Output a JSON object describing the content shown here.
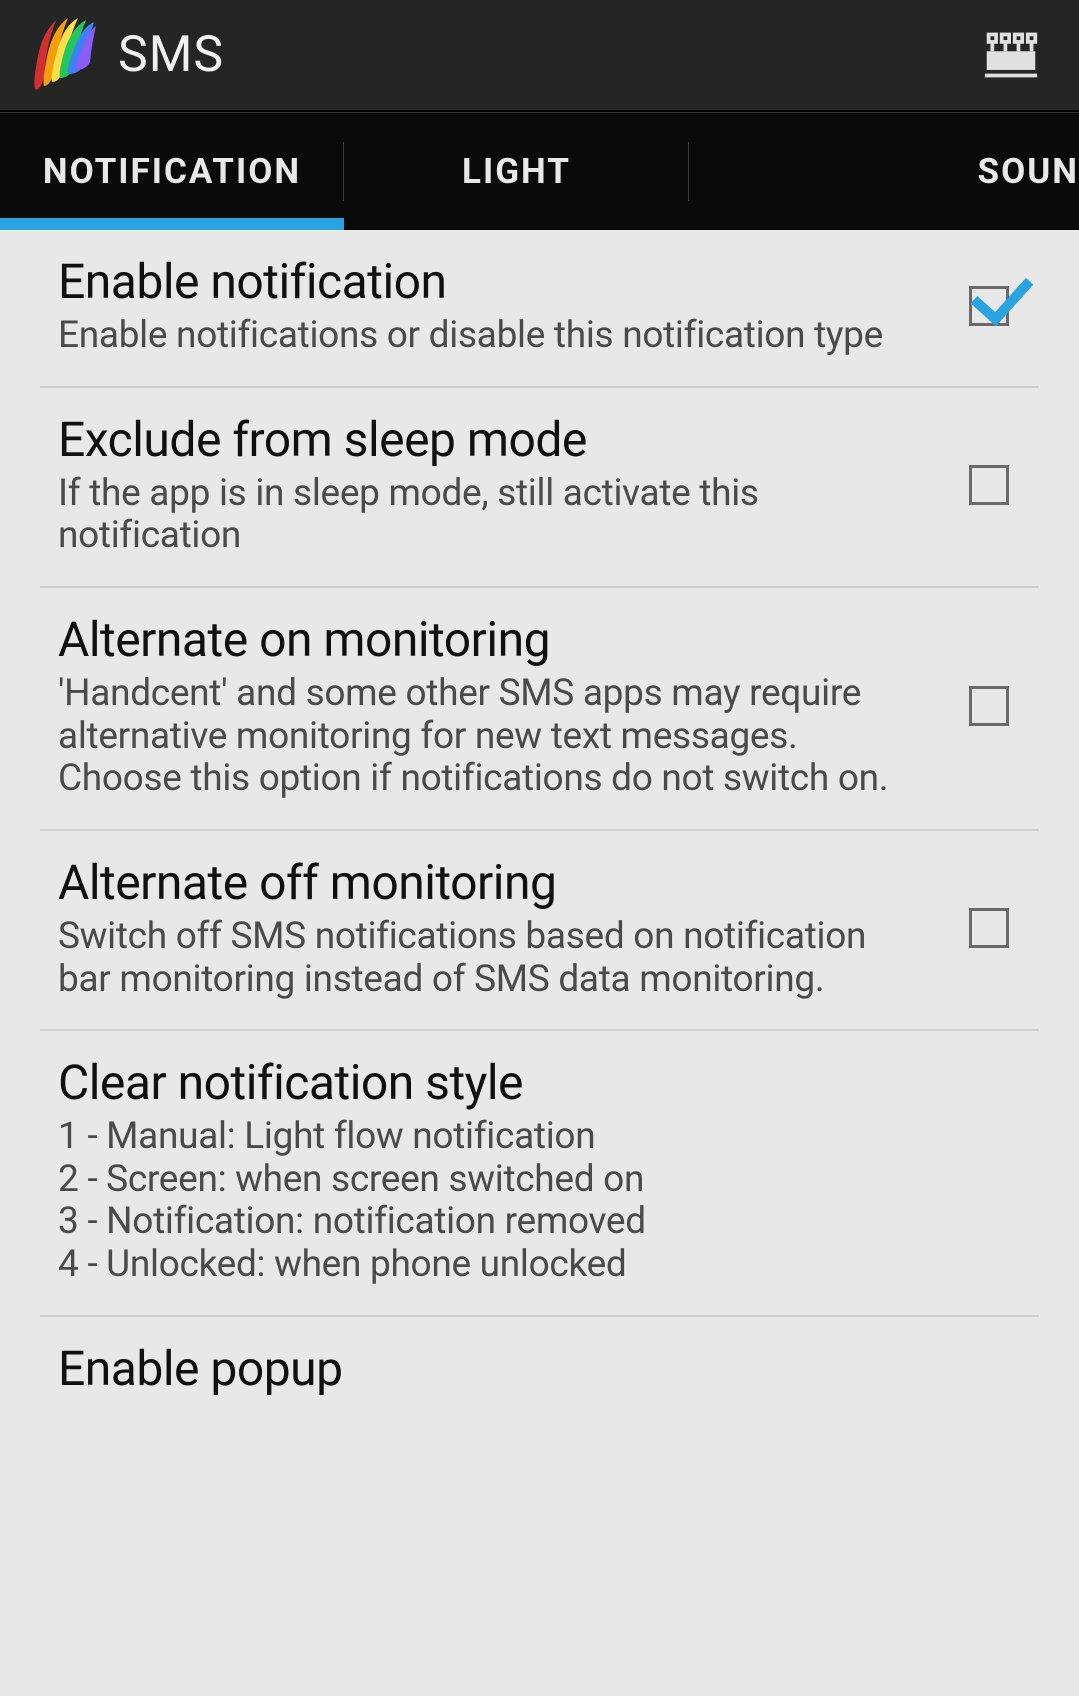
{
  "header": {
    "title": "SMS"
  },
  "tabs": [
    {
      "label": "NOTIFICATION",
      "active": true
    },
    {
      "label": "LIGHT",
      "active": false
    },
    {
      "label": "SOUN",
      "active": false
    }
  ],
  "settings": [
    {
      "title": "Enable notification",
      "desc": "Enable notifications or disable this notification type",
      "has_checkbox": true,
      "checked": true
    },
    {
      "title": "Exclude from sleep mode",
      "desc": "If the app is in sleep mode, still activate this notification",
      "has_checkbox": true,
      "checked": false
    },
    {
      "title": "Alternate on monitoring",
      "desc": "'Handcent' and some other SMS apps may require alternative monitoring for new text messages. Choose this option if notifications do not switch on.",
      "has_checkbox": true,
      "checked": false
    },
    {
      "title": "Alternate off monitoring",
      "desc": "Switch off SMS notifications based on notification bar monitoring instead of SMS data monitoring.",
      "has_checkbox": true,
      "checked": false
    },
    {
      "title": "Clear notification style",
      "desc": "1 - Manual: Light flow notification\n2 - Screen: when screen switched on\n3 - Notification: notification removed\n4 - Unlocked: when phone unlocked",
      "has_checkbox": false,
      "checked": false
    },
    {
      "title": "Enable popup",
      "desc": "",
      "has_checkbox": false,
      "checked": false
    }
  ]
}
